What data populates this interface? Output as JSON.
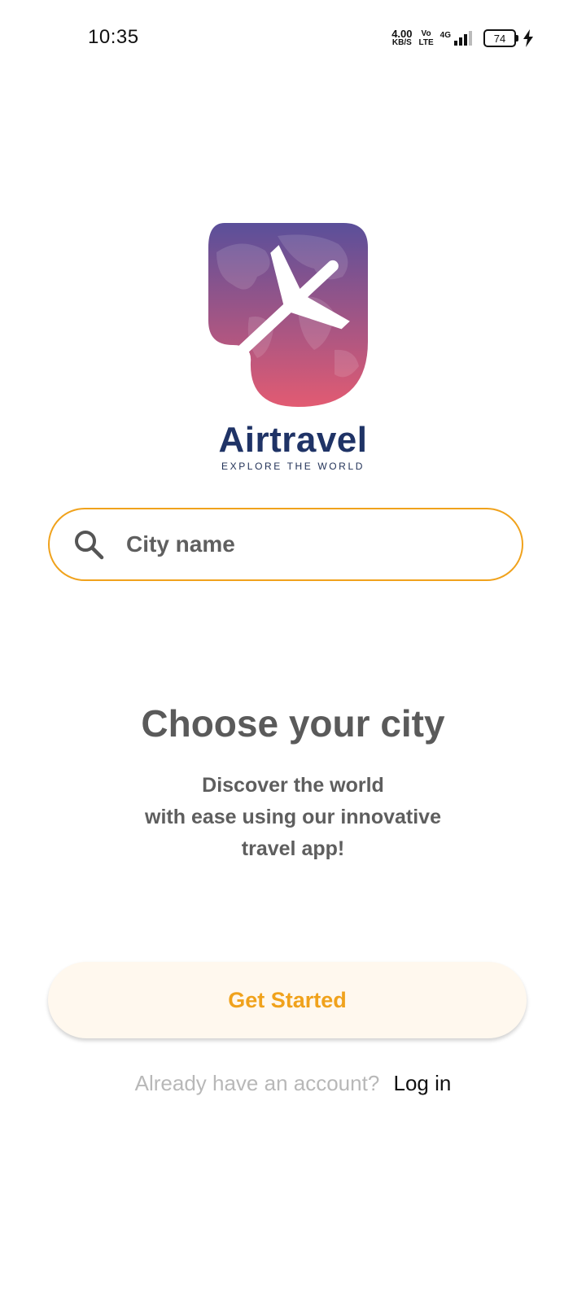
{
  "status_bar": {
    "time": "10:35",
    "net_speed": "4.00",
    "net_unit": "KB/S",
    "volte_top": "Vo",
    "volte_bottom": "LTE",
    "network": "4G",
    "battery": "74"
  },
  "brand": {
    "name": "Airtravel",
    "tagline": "EXPLORE THE WORLD",
    "gradient_top": "#5a4f9a",
    "gradient_bottom": "#e25b72"
  },
  "search": {
    "placeholder": "City name",
    "icon": "search-icon",
    "border_color": "#f0a21c"
  },
  "main": {
    "headline": "Choose your city",
    "sub_line1": "Discover the world",
    "sub_line2": "with ease using our innovative",
    "sub_line3": "travel app!"
  },
  "actions": {
    "get_started_label": "Get Started",
    "login_prompt": "Already have an account?",
    "login_link": "Log in",
    "accent": "#f0a21c"
  }
}
